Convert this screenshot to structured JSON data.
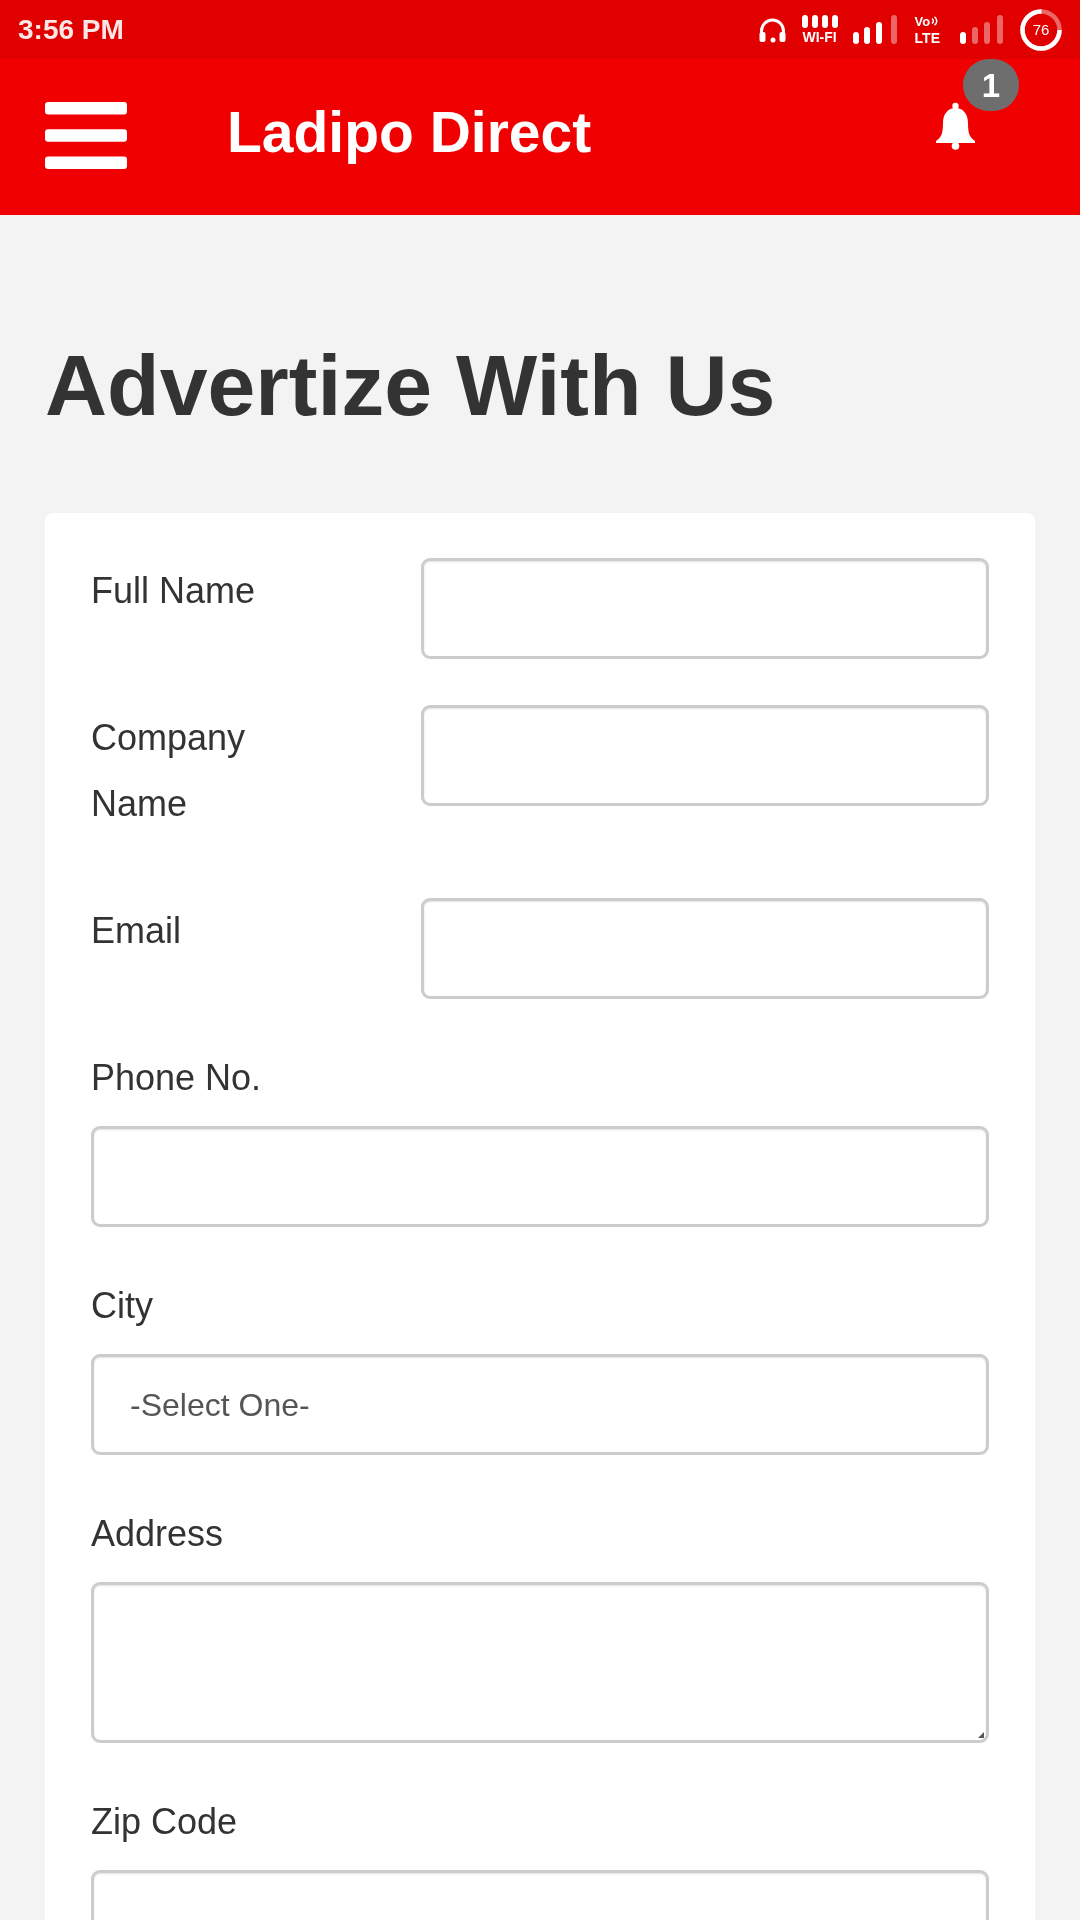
{
  "status_bar": {
    "time": "3:56 PM",
    "wifi_label": "WI-FI",
    "volte_label": "Vo",
    "network_label": "LTE",
    "battery": "76"
  },
  "app_bar": {
    "title": "Ladipo Direct",
    "notification_count": "1"
  },
  "page_title": "Advertize With Us",
  "form": {
    "inline_fields": [
      {
        "label": "Full Name",
        "kind": "text"
      },
      {
        "label": "Company Name",
        "kind": "text"
      },
      {
        "label": "Email",
        "kind": "text"
      }
    ],
    "stacked_fields": [
      {
        "label": "Phone No.",
        "kind": "text"
      },
      {
        "label": "City",
        "kind": "select",
        "value": "-Select One-"
      },
      {
        "label": "Address",
        "kind": "textarea"
      },
      {
        "label": "Zip Code",
        "kind": "text"
      }
    ]
  }
}
